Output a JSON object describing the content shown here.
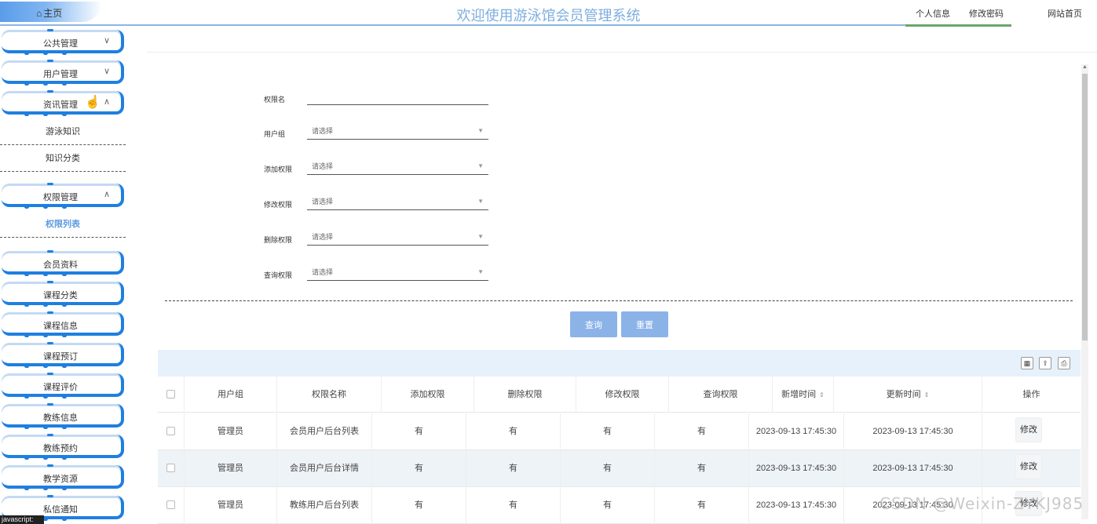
{
  "header": {
    "home_label": "主页",
    "title": "欢迎使用游泳馆会员管理系统",
    "nav": [
      "个人信息",
      "修改密码",
      "网站首页"
    ]
  },
  "sidebar": {
    "menus": [
      {
        "label": "公共管理",
        "chevron": "∨"
      },
      {
        "label": "用户管理",
        "chevron": "∨"
      },
      {
        "label": "资讯管理",
        "chevron": "∧"
      },
      {
        "label": "权限管理",
        "chevron": "∧"
      },
      {
        "label": "会员资料"
      },
      {
        "label": "课程分类"
      },
      {
        "label": "课程信息"
      },
      {
        "label": "课程预订"
      },
      {
        "label": "课程评价"
      },
      {
        "label": "教练信息"
      },
      {
        "label": "教练预约"
      },
      {
        "label": "教学资源"
      },
      {
        "label": "私信通知"
      }
    ],
    "sub_items": [
      "游泳知识",
      "知识分类",
      "权限列表"
    ],
    "status": "javascript:"
  },
  "form": {
    "fields": [
      {
        "label": "权限名",
        "placeholder": ""
      },
      {
        "label": "用户组",
        "value": "请选择"
      },
      {
        "label": "添加权限",
        "value": "请选择"
      },
      {
        "label": "修改权限",
        "value": "请选择"
      },
      {
        "label": "删除权限",
        "value": "请选择"
      },
      {
        "label": "查询权限",
        "value": "请选择"
      }
    ],
    "search_label": "查询",
    "reset_label": "重置"
  },
  "table": {
    "columns": [
      "用户组",
      "权限名称",
      "添加权限",
      "删除权限",
      "修改权限",
      "查询权限",
      "新增时间",
      "更新时间",
      "操作"
    ],
    "rows": [
      [
        "管理员",
        "会员用户后台列表",
        "有",
        "有",
        "有",
        "有",
        "2023-09-13 17:45:30",
        "2023-09-13 17:45:30",
        "修改"
      ],
      [
        "管理员",
        "会员用户后台详情",
        "有",
        "有",
        "有",
        "有",
        "2023-09-13 17:45:30",
        "2023-09-13 17:45:30",
        "修改"
      ],
      [
        "管理员",
        "教练用户后台列表",
        "有",
        "有",
        "有",
        "有",
        "2023-09-13 17:45:30",
        "2023-09-13 17:45:30",
        "修改"
      ]
    ]
  },
  "watermark": "CSDN @Weixin-ZYKJ985",
  "colors": {
    "accent": "#1f7fe0",
    "button": "#8bb3e8",
    "title": "#7eaee0",
    "toolbar": "#e6f1fc"
  }
}
